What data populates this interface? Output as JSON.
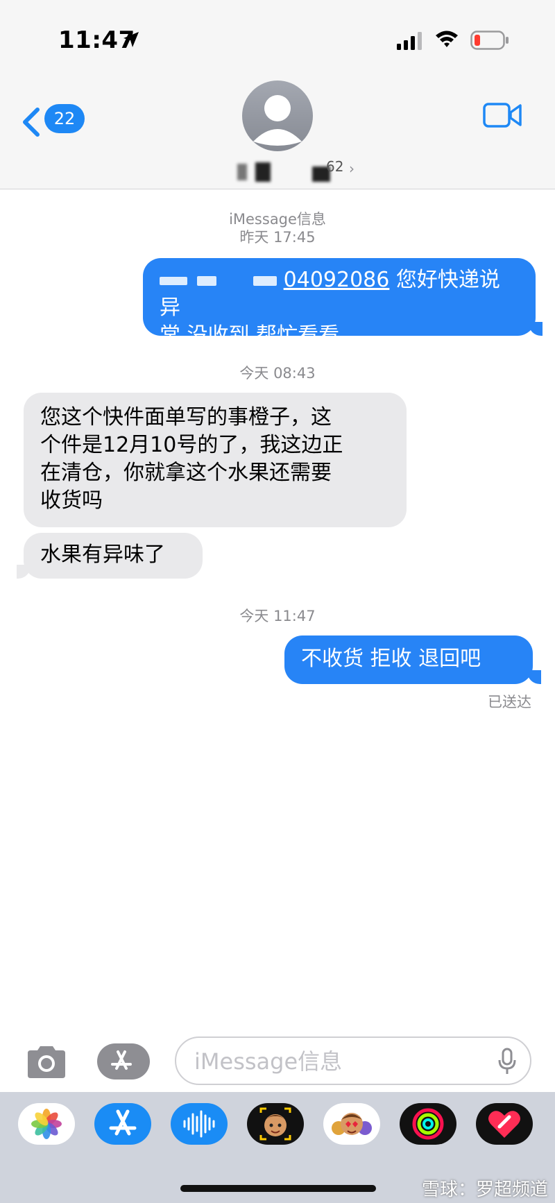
{
  "status_bar": {
    "time": "11:47"
  },
  "header": {
    "back_badge": "22",
    "contact_suffix": "62"
  },
  "chat": {
    "service_label": "iMessage信息",
    "groups": [
      {
        "timestamp": "昨天 17:45",
        "messages": [
          {
            "direction": "outgoing",
            "partial_number": "04092086",
            "text_line1": "您好快递说异",
            "text_line2": "常 没收到 帮忙看看"
          }
        ]
      },
      {
        "timestamp": "今天 08:43",
        "messages": [
          {
            "direction": "incoming",
            "lines": [
              "您这个快件面单写的事橙子，这",
              "个件是12月10号的了，我这边正",
              "在清仓，你就拿这个水果还需要",
              "收货吗"
            ]
          },
          {
            "direction": "incoming",
            "text": "水果有异味了"
          }
        ]
      },
      {
        "timestamp": "今天 11:47",
        "messages": [
          {
            "direction": "outgoing",
            "text": "不收货 拒收 退回吧"
          }
        ]
      }
    ],
    "delivery_status": "已送达"
  },
  "input_bar": {
    "placeholder": "iMessage信息"
  },
  "app_drawer": {
    "apps": [
      "photos-icon",
      "app-store-icon",
      "audio-message-icon",
      "memoji-icon",
      "animoji-stickers-icon",
      "activity-icon",
      "digital-touch-icon"
    ]
  },
  "watermark": "雪球：罗超频道",
  "colors": {
    "accent": "#2784f6",
    "incoming_bubble": "#e9e9eb",
    "header_bg": "#f6f6f6",
    "drawer_bg": "#cfd3dc"
  }
}
